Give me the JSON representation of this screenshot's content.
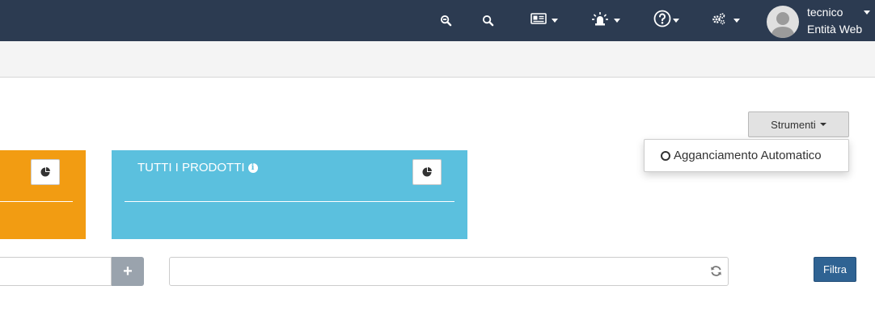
{
  "header": {
    "icons": [
      "zoom-out-icon",
      "search-icon",
      "id-card-icon",
      "siren-icon",
      "help-icon",
      "settings-icon"
    ],
    "user": {
      "name": "tecnico",
      "organization": "Entità Web"
    }
  },
  "toolbar": {
    "tools_label": "Strumenti",
    "dropdown": {
      "item_label": "Agganciamento Automatico"
    }
  },
  "cards": {
    "blue": {
      "title": "TUTTI I PRODOTTI"
    }
  },
  "filters": {
    "add_label": "+",
    "filter_label": "Filtra"
  },
  "colors": {
    "topbar": "#2c3b51",
    "orange_card": "#f29c12",
    "blue_card": "#5bc0de",
    "primary_button": "#2f6393"
  }
}
